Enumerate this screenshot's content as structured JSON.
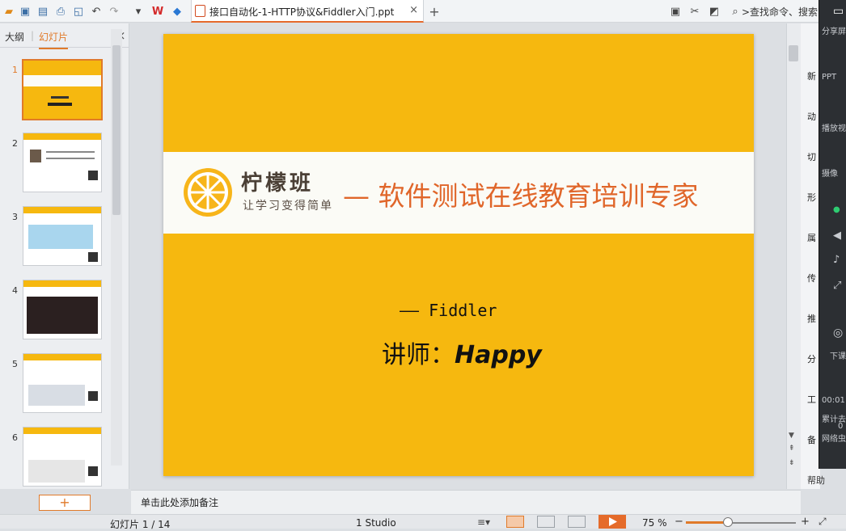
{
  "app": {
    "search_placeholder": ">查找命令、搜索"
  },
  "document_tab": {
    "title": "接口自动化-1-HTTP协议&Fiddler入门.ppt",
    "close": "×",
    "new_tab": "+"
  },
  "left_panel": {
    "tabs": [
      {
        "label": "大纲"
      },
      {
        "label": "幻灯片"
      }
    ],
    "close": "×",
    "slides": [
      "1",
      "2",
      "3",
      "4",
      "5",
      "6"
    ],
    "add_button": "+"
  },
  "slide": {
    "brand": "柠檬班",
    "brand_sub": "让学习变得简单",
    "tagline": "— 软件测试在线教育培训专家",
    "subtitle_dash": "——",
    "subtitle": "Fiddler",
    "lecturer_prefix": "讲师：",
    "lecturer_name": "Happy"
  },
  "task_panel": {
    "items": [
      "新",
      "动",
      "切",
      "形",
      "属",
      "传",
      "推",
      "分",
      "工",
      "备"
    ],
    "help": "帮助"
  },
  "share_overlay": {
    "items": [
      "分享屏",
      "PPT",
      "播放视",
      "摄像",
      "下课",
      "00:01",
      "累计去",
      "0",
      "网络虫"
    ]
  },
  "notes": {
    "placeholder": "单击此处添加备注"
  },
  "status": {
    "slide_counter": "幻灯片 1 / 14",
    "theme": "1 Studio",
    "zoom": "75 %"
  },
  "colors": {
    "accent": "#e07a2a",
    "slide_bg": "#f6b80f",
    "tagline": "#e0662a"
  }
}
